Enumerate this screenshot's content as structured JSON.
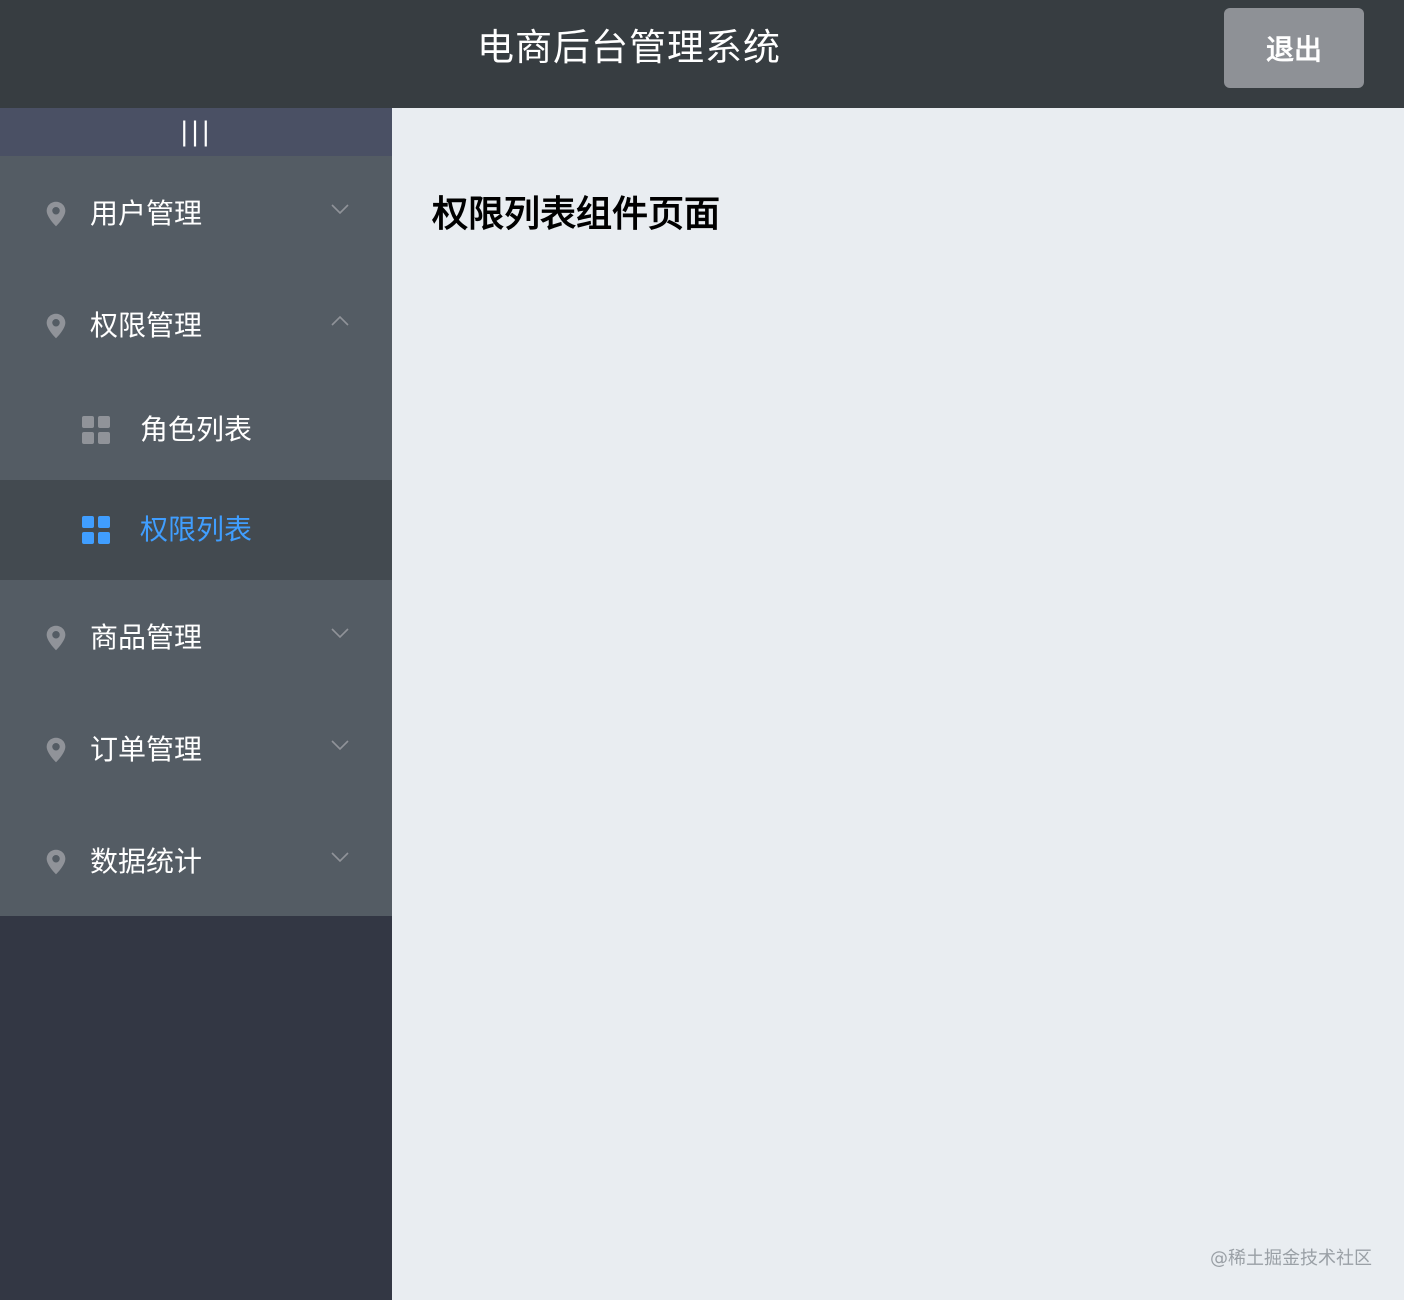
{
  "header": {
    "title": "电商后台管理系统",
    "logout_label": "退出"
  },
  "sidebar": {
    "toggle_label": "|||",
    "menus": [
      {
        "label": "用户管理",
        "expanded": false,
        "icon": "location-icon"
      },
      {
        "label": "权限管理",
        "expanded": true,
        "icon": "location-icon",
        "children": [
          {
            "label": "角色列表",
            "active": false,
            "icon": "grid-icon"
          },
          {
            "label": "权限列表",
            "active": true,
            "icon": "grid-icon"
          }
        ]
      },
      {
        "label": "商品管理",
        "expanded": false,
        "icon": "location-icon"
      },
      {
        "label": "订单管理",
        "expanded": false,
        "icon": "location-icon"
      },
      {
        "label": "数据统计",
        "expanded": false,
        "icon": "location-icon"
      }
    ]
  },
  "main": {
    "heading": "权限列表组件页面"
  },
  "watermark": "@稀土掘金技术社区",
  "colors": {
    "header_bg": "#373d41",
    "sidebar_bg": "#333744",
    "menu_bg": "#545c64",
    "active_bg": "#434a50",
    "active_text": "#409eff",
    "content_bg": "#e9edf1"
  }
}
